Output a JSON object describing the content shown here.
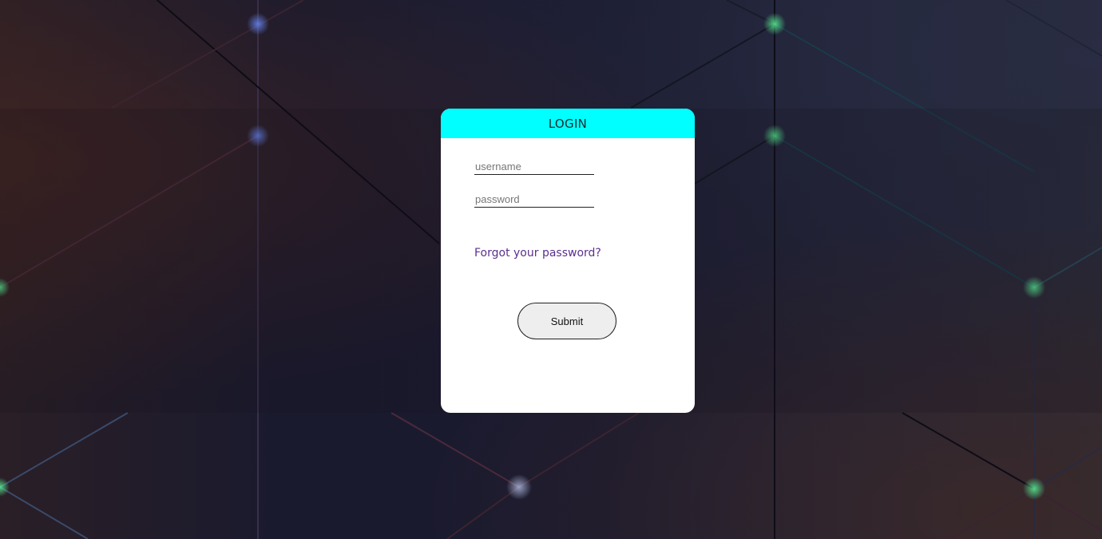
{
  "login": {
    "title": "LOGIN",
    "username_placeholder": "username",
    "password_placeholder": "password",
    "forgot_link": "Forgot your password?",
    "submit_label": "Submit"
  },
  "colors": {
    "header_accent": "#00ffff",
    "link": "#5b2f8f",
    "card_bg": "#ffffff"
  }
}
